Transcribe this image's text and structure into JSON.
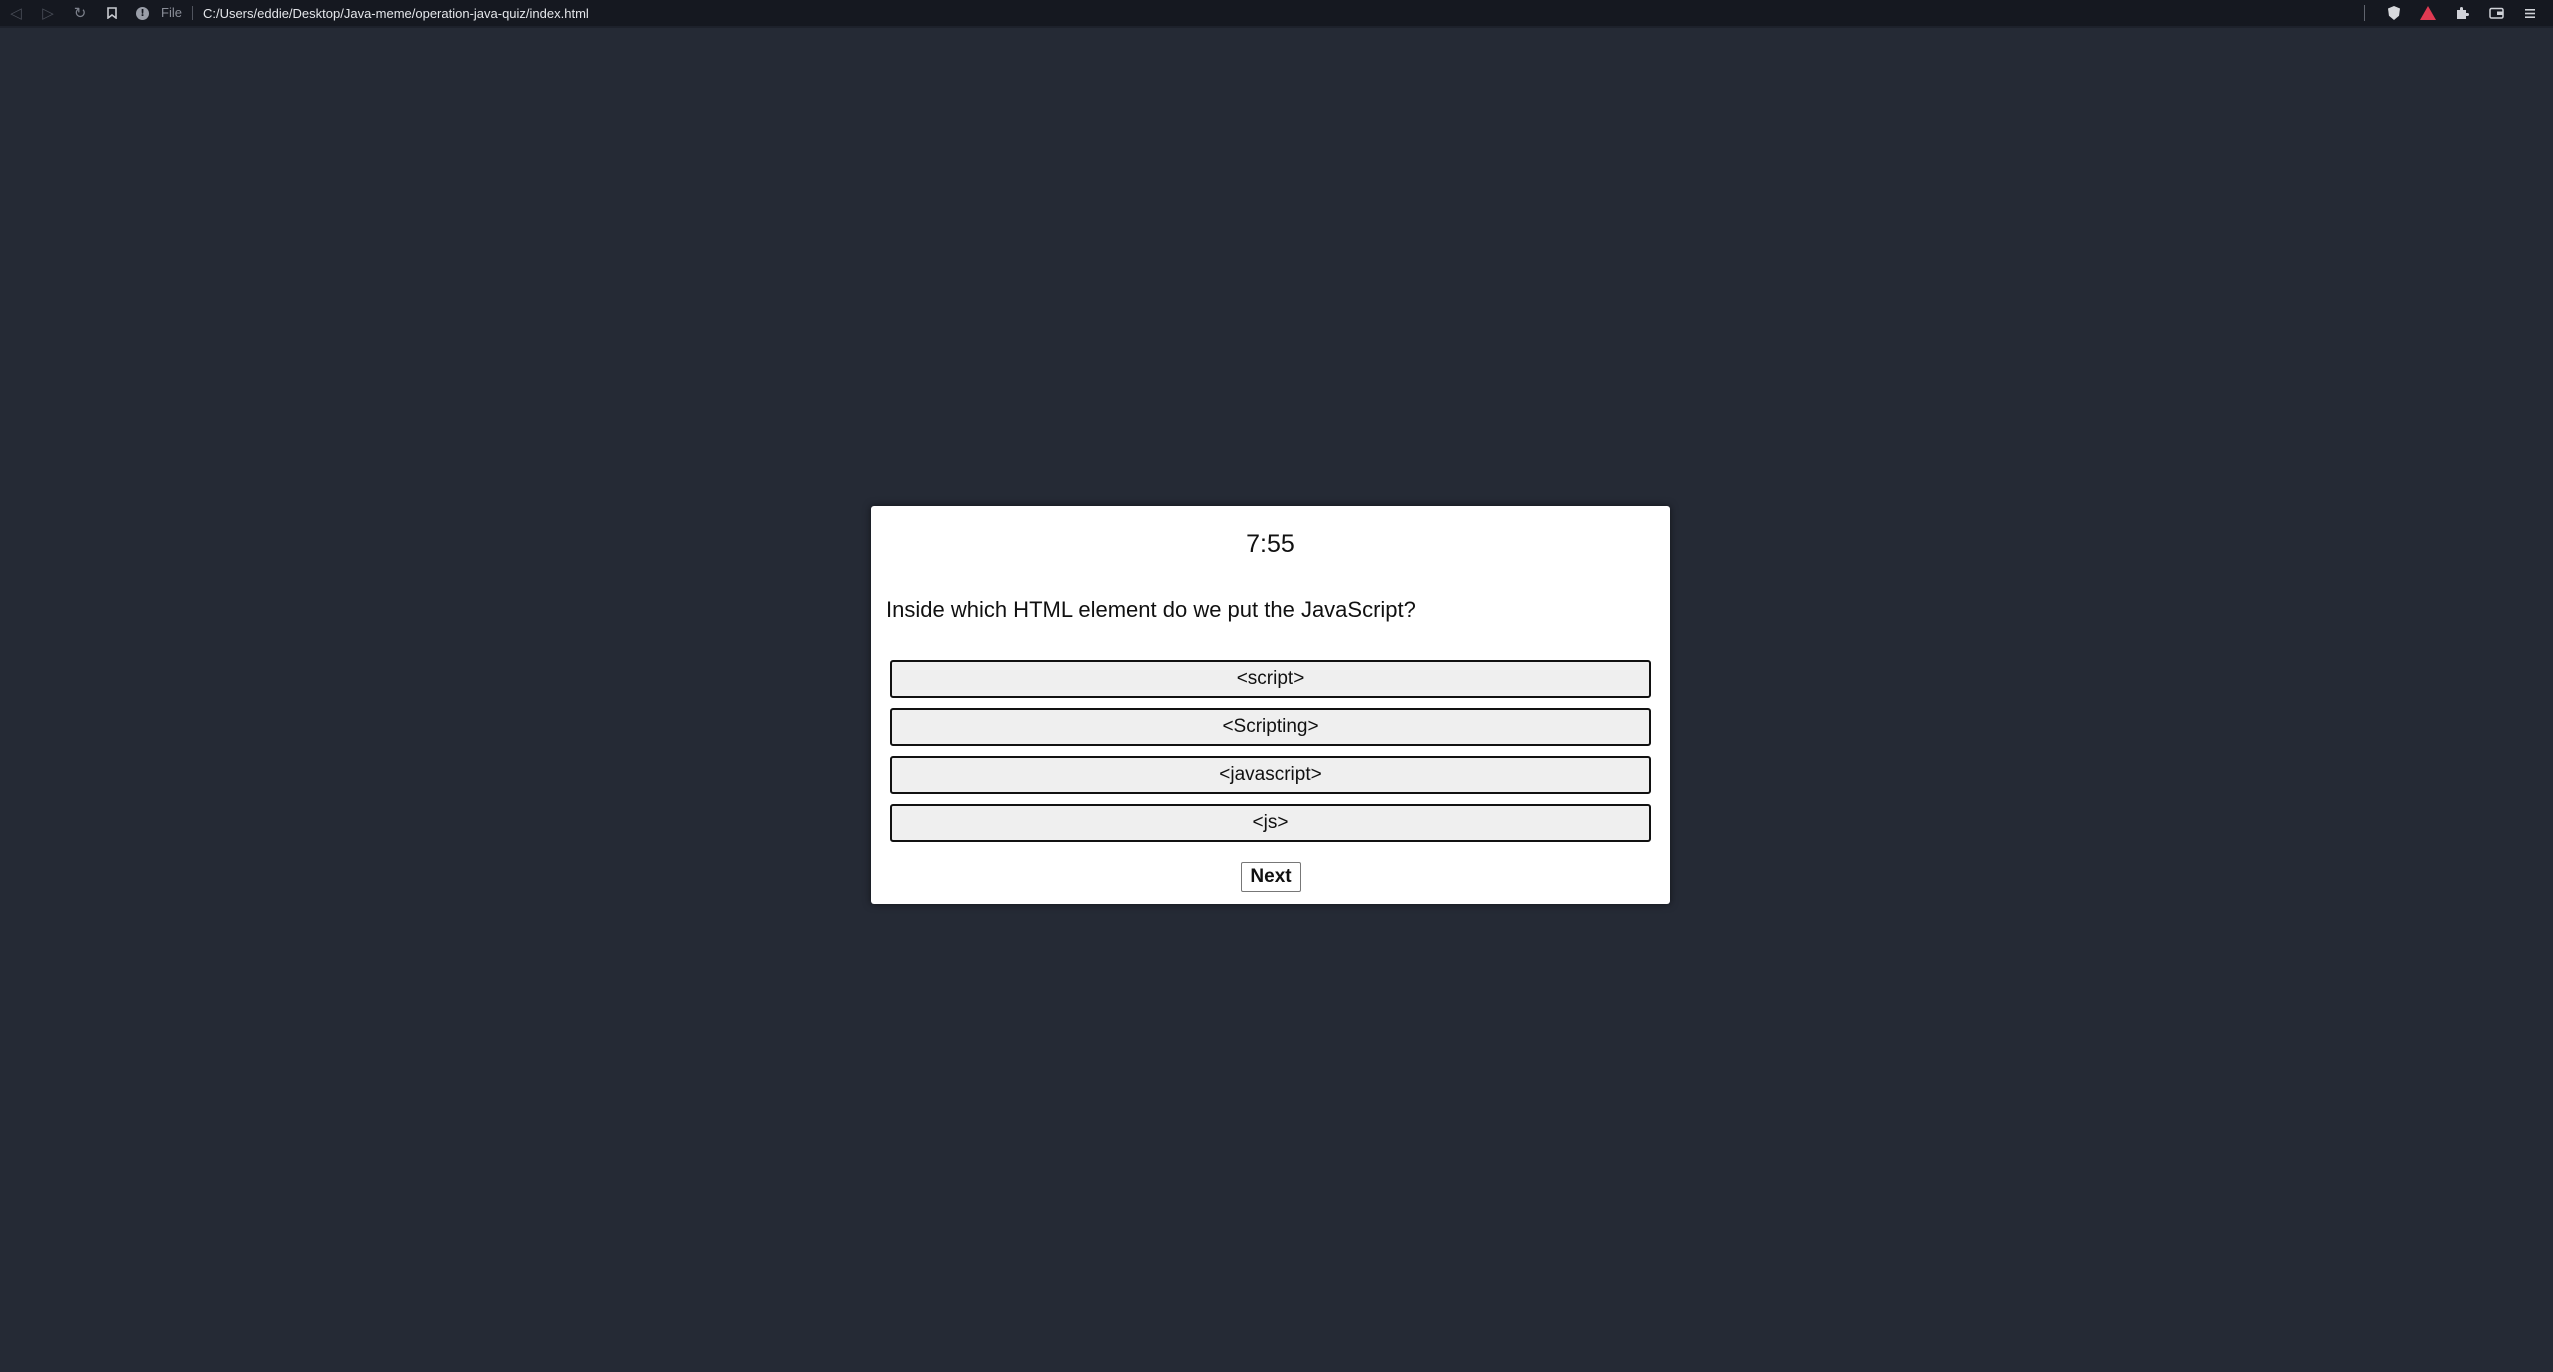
{
  "browser": {
    "back_icon": "back-arrow-icon",
    "forward_icon": "forward-arrow-icon",
    "reload_icon": "reload-icon",
    "bookmark_icon": "bookmark-icon",
    "scheme_label": "File",
    "url": "C:/Users/eddie/Desktop/Java-meme/operation-java-quiz/index.html",
    "tools": [
      "brave-shield-icon",
      "brave-rewards-icon",
      "extensions-icon",
      "wallet-icon",
      "menu-icon"
    ]
  },
  "quiz": {
    "timer": "7:55",
    "question": "Inside which HTML element do we put the JavaScript?",
    "answers": [
      {
        "label": "<script>"
      },
      {
        "label": "<Scripting>"
      },
      {
        "label": "<javascript>"
      },
      {
        "label": "<js>"
      }
    ],
    "next_label": "Next"
  },
  "colors": {
    "page_background": "#252a35",
    "toolbar_background": "#151820",
    "card_background": "#ffffff",
    "answer_background": "#efefef",
    "rewards_accent": "#e03a52"
  }
}
